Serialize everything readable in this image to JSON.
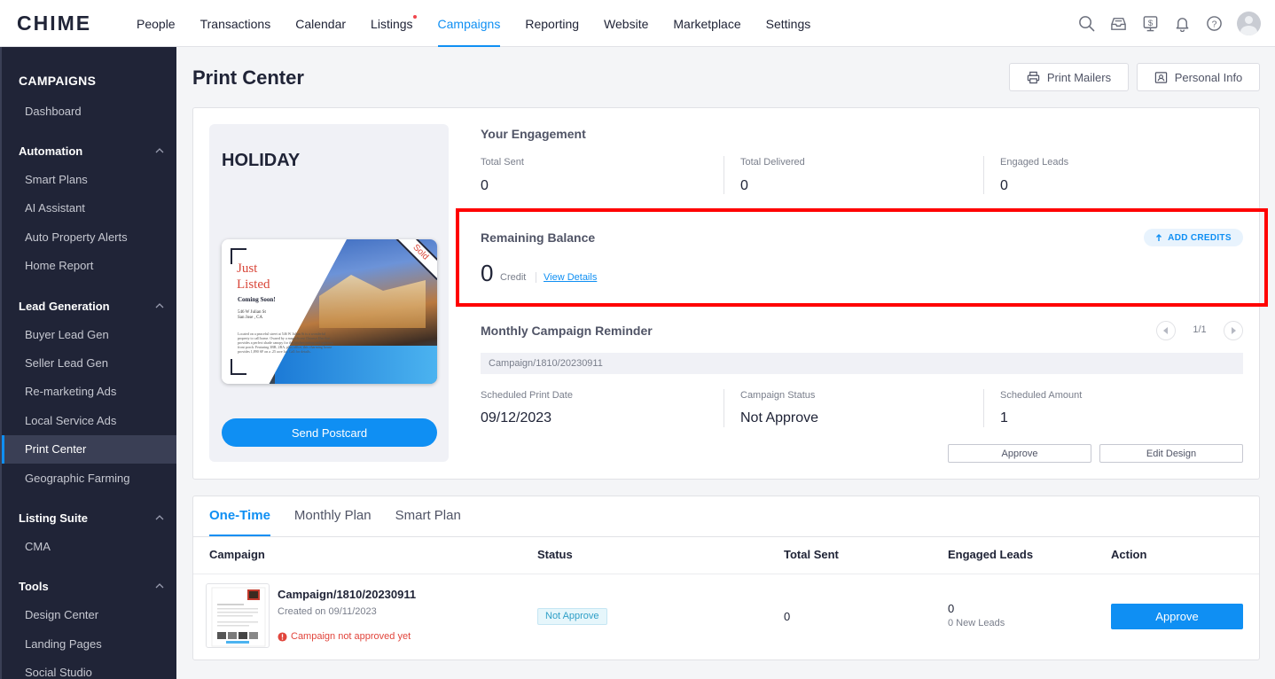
{
  "app": {
    "logo": "CHIME"
  },
  "nav": {
    "items": [
      {
        "label": "People"
      },
      {
        "label": "Transactions"
      },
      {
        "label": "Calendar"
      },
      {
        "label": "Listings"
      },
      {
        "label": "Campaigns"
      },
      {
        "label": "Reporting"
      },
      {
        "label": "Website"
      },
      {
        "label": "Marketplace"
      },
      {
        "label": "Settings"
      }
    ],
    "active": "Campaigns",
    "icons": [
      "search-icon",
      "inbox-icon",
      "dollar-icon",
      "bell-icon",
      "help-icon",
      "avatar"
    ]
  },
  "sidebar": {
    "title": "CAMPAIGNS",
    "dashboard": "Dashboard",
    "sections": {
      "automation": {
        "label": "Automation",
        "items": [
          "Smart Plans",
          "AI Assistant",
          "Auto Property Alerts",
          "Home Report"
        ]
      },
      "lead_generation": {
        "label": "Lead Generation",
        "items": [
          "Buyer Lead Gen",
          "Seller Lead Gen",
          "Re-marketing Ads",
          "Local Service Ads",
          "Print Center",
          "Geographic Farming"
        ]
      },
      "listing_suite": {
        "label": "Listing Suite",
        "items": [
          "CMA"
        ]
      },
      "tools": {
        "label": "Tools",
        "items": [
          "Design Center",
          "Landing Pages",
          "Social Studio"
        ]
      }
    },
    "active_item": "Print Center"
  },
  "page": {
    "title": "Print Center",
    "print_mailers": "Print Mailers",
    "personal_info": "Personal Info"
  },
  "holiday": {
    "title": "HOLIDAY",
    "postcard": {
      "headline_1": "Just",
      "headline_2": "Listed",
      "coming_soon": "Coming Soon!",
      "address_1": "546 W Julian St",
      "address_2": "San Jose , CA",
      "body": "Located on a peaceful street at 546 W Julian St is a wonderful property to call home. Owned by a magnificent Chinese Elm that provides a perfect shade canopy for the kitchen eating and spacious front porch. Featuring 3BR, 2BA, plus office, this charming house provides 1,890 SF on a .25 acre lot. Call for details.",
      "sold": "Sold"
    },
    "send_button": "Send Postcard"
  },
  "engagement": {
    "title": "Your Engagement",
    "metrics": [
      {
        "label": "Total Sent",
        "value": "0"
      },
      {
        "label": "Total Delivered",
        "value": "0"
      },
      {
        "label": "Engaged Leads",
        "value": "0"
      }
    ]
  },
  "balance": {
    "title": "Remaining Balance",
    "add_credits": "ADD CREDITS",
    "amount": "0",
    "unit": "Credit",
    "view_details": "View Details",
    "highlight_color": "#ff0000"
  },
  "reminder": {
    "title": "Monthly Campaign Reminder",
    "pager": "1/1",
    "campaign": "Campaign/1810/20230911",
    "fields": [
      {
        "label": "Scheduled Print Date",
        "value": "09/12/2023"
      },
      {
        "label": "Campaign Status",
        "value": "Not Approve"
      },
      {
        "label": "Scheduled Amount",
        "value": "1"
      }
    ],
    "approve": "Approve",
    "edit_design": "Edit Design"
  },
  "tabs": {
    "items": [
      "One-Time",
      "Monthly Plan",
      "Smart Plan"
    ],
    "active": "One-Time"
  },
  "table": {
    "headers": [
      "Campaign",
      "Status",
      "Total Sent",
      "Engaged Leads",
      "Action"
    ],
    "rows": [
      {
        "name": "Campaign/1810/20230911",
        "created": "Created on 09/11/2023",
        "warning": "Campaign not approved yet",
        "status": "Not Approve",
        "total_sent": "0",
        "engaged": "0",
        "new_leads": "0 New Leads",
        "action": "Approve"
      }
    ]
  },
  "colors": {
    "accent": "#0f8ff3",
    "sidebar_bg": "#202437",
    "danger": "#e1453c"
  }
}
